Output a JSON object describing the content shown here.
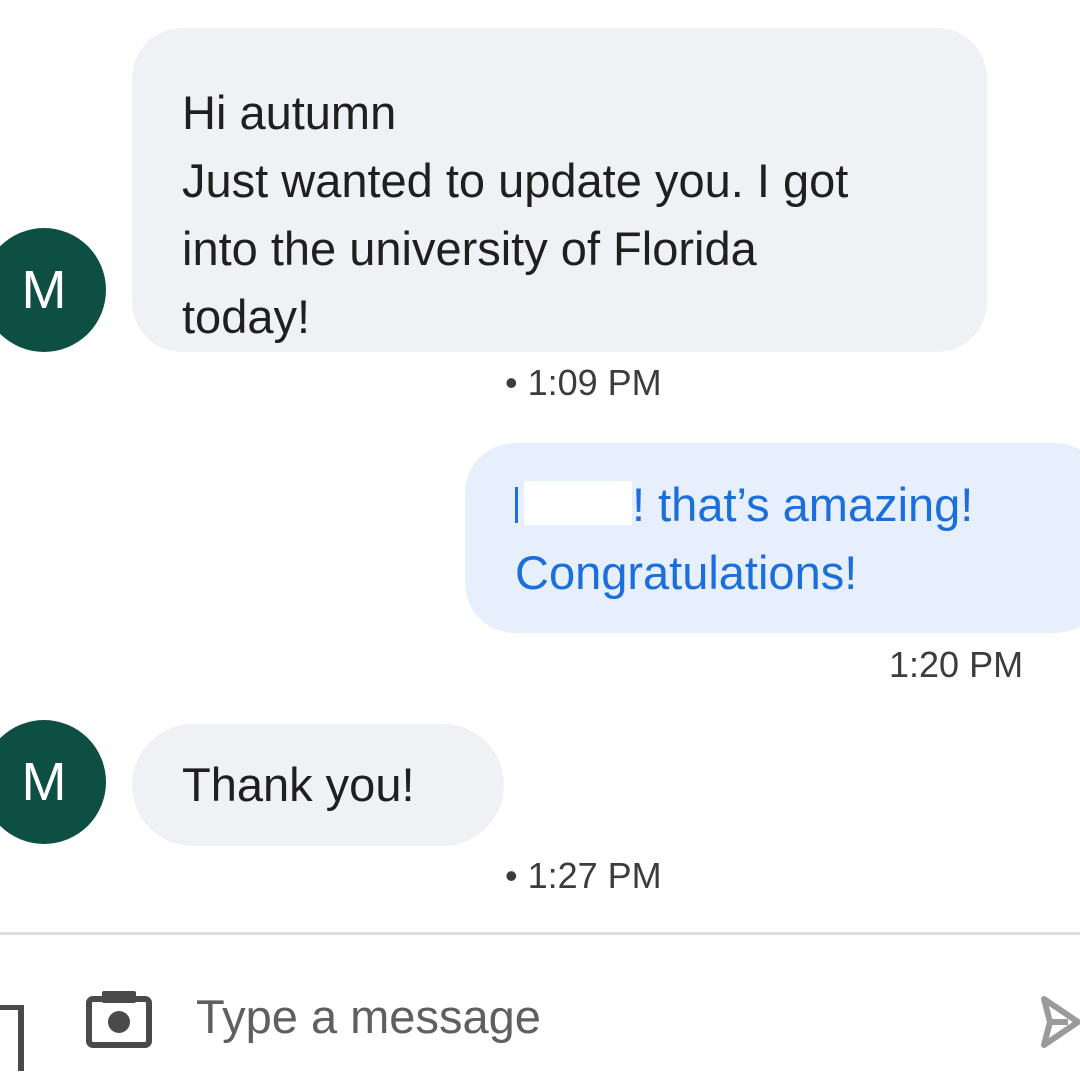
{
  "messages": [
    {
      "direction": "incoming",
      "avatar_initial": "M",
      "lines": [
        "Hi autumn",
        "Just wanted to update you. I got",
        "into the university of Florida",
        "today!"
      ],
      "time": "• 1:09 PM"
    },
    {
      "direction": "outgoing",
      "lines": [
        "! that’s amazing!",
        "Congratulations!"
      ],
      "time": "1:20 PM"
    },
    {
      "direction": "incoming",
      "avatar_initial": "M",
      "lines": [
        "Thank you!"
      ],
      "time": "• 1:27 PM"
    }
  ],
  "composer": {
    "placeholder": "Type a message",
    "camera_icon": "camera-icon",
    "send_icon": "send-icon"
  },
  "colors": {
    "avatar": "#0d4f43",
    "incoming_bubble": "#f0f1f4",
    "outgoing_bubble": "#e7effc",
    "outgoing_text": "#1b6fdc"
  }
}
